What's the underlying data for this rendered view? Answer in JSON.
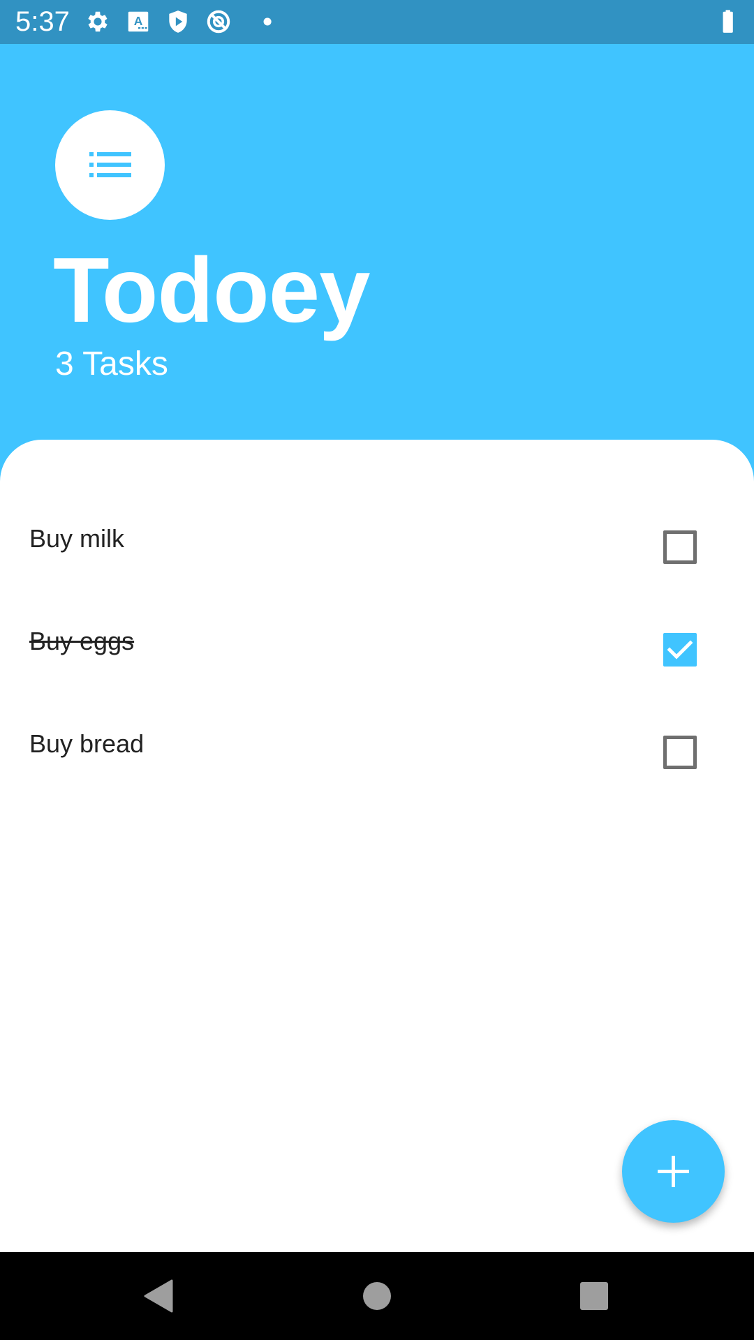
{
  "status_bar": {
    "time": "5:37",
    "icons": [
      "gear-icon",
      "text-a-icon",
      "play-shield-icon",
      "no-sync-icon",
      "dot-icon",
      "battery-icon"
    ]
  },
  "header": {
    "icon": "list-icon",
    "title": "Todoey",
    "task_count": "3 Tasks"
  },
  "tasks": [
    {
      "label": "Buy milk",
      "done": false
    },
    {
      "label": "Buy eggs",
      "done": true
    },
    {
      "label": "Buy bread",
      "done": false
    }
  ],
  "fab": {
    "icon": "plus-icon"
  },
  "nav_bar": {
    "icons": [
      "back-icon",
      "home-icon",
      "recents-icon"
    ]
  },
  "colors": {
    "accent": "#40c4ff",
    "status_bar": "#3192c2",
    "checkbox_border": "#6f6f6f",
    "nav_bar": "#000000"
  }
}
